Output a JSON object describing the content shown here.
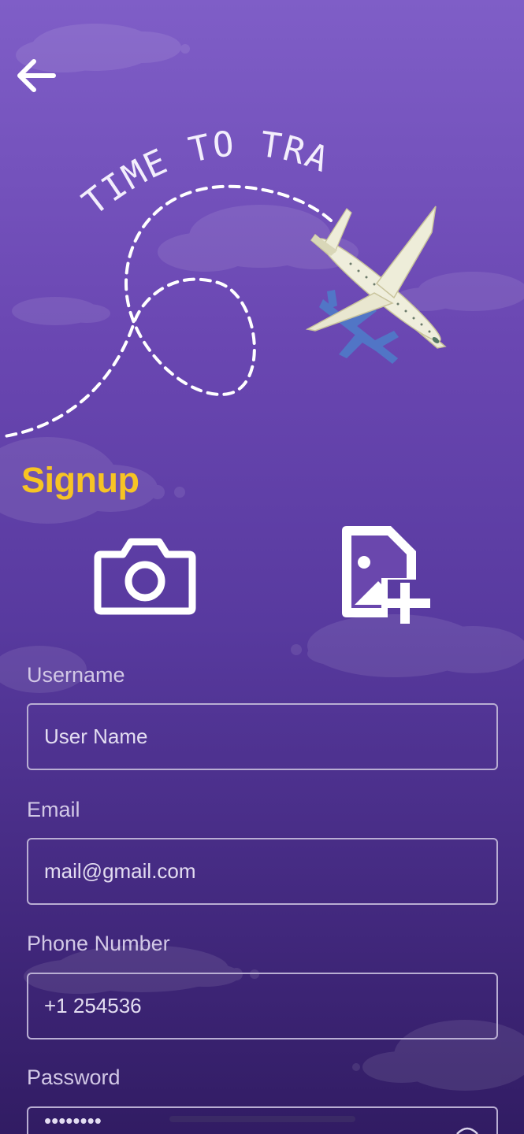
{
  "header": {
    "back_icon": "arrow-left-icon"
  },
  "hero": {
    "illustration_text": "TIME TO TRAVEL",
    "plane_icon": "airplane-icon"
  },
  "signup": {
    "title": "Signup",
    "camera_icon": "camera-icon",
    "gallery_icon": "add-image-icon",
    "fields": [
      {
        "label": "Username",
        "placeholder": "User Name"
      },
      {
        "label": "Email",
        "placeholder": "mail@gmail.com"
      },
      {
        "label": "Phone Number",
        "placeholder": "+1 254536"
      },
      {
        "label": "Password",
        "placeholder": "••••••••"
      }
    ]
  },
  "colors": {
    "title": "#f7c424",
    "background_top": "#7f5ec7",
    "background_bottom": "#311c63",
    "field_border": "#b9aed3"
  }
}
